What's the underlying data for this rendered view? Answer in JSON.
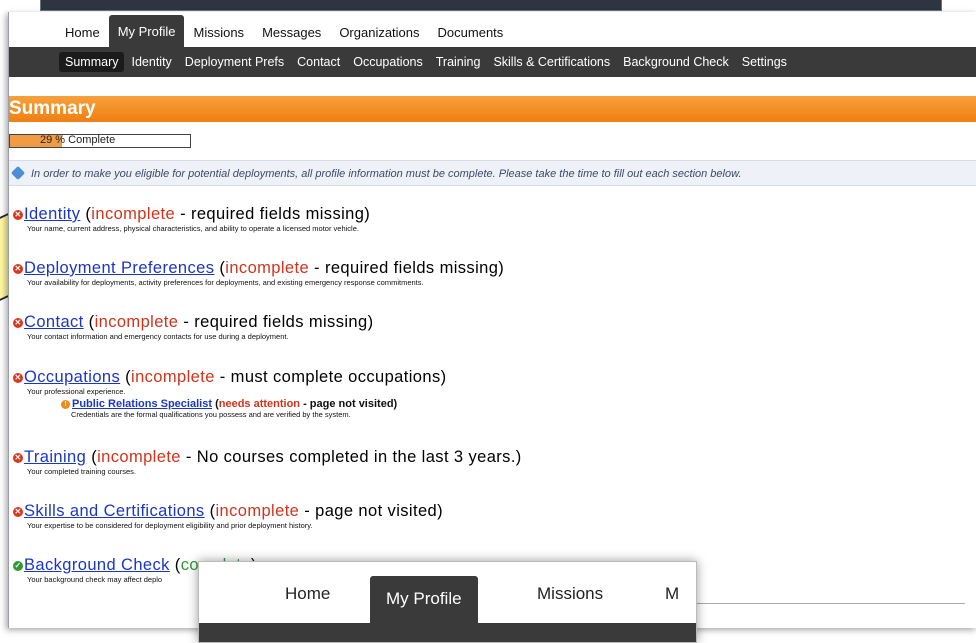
{
  "nav": {
    "main_tabs": [
      "Home",
      "My Profile",
      "Missions",
      "Messages",
      "Organizations",
      "Documents"
    ],
    "sub_tabs": [
      "Summary",
      "Identity",
      "Deployment Prefs",
      "Contact",
      "Occupations",
      "Training",
      "Skills & Certifications",
      "Background Check",
      "Settings"
    ]
  },
  "page": {
    "title": "Summary",
    "progress": {
      "percent": 29,
      "label": "29 % Complete"
    },
    "info_text": "In order to make you eligible for potential deployments, all profile information must be complete. Please take the time to fill out each section below."
  },
  "sections": {
    "identity": {
      "link": "Identity",
      "open": "(",
      "status": "incomplete",
      "rest": " - required fields missing)",
      "desc": "Your name, current address, physical characteristics, and ability to operate a licensed motor vehicle."
    },
    "deployment": {
      "link": "Deployment Preferences",
      "open": "(",
      "status": "incomplete",
      "rest": " - required fields missing)",
      "desc": "Your availability for deployments, activity preferences for deployments, and existing emergency response commitments."
    },
    "contact": {
      "link": "Contact",
      "open": "(",
      "status": "incomplete",
      "rest": " - required fields missing)",
      "desc": "Your contact information and emergency contacts for use during a deployment."
    },
    "occupations": {
      "link": "Occupations",
      "open": "(",
      "status": "incomplete",
      "rest": " - must complete occupations)",
      "desc": "Your professional experience.",
      "sub": {
        "link": "Public Relations Specialist",
        "open": "(",
        "status": "needs attention",
        "rest": " - page not visited)",
        "desc": "Credentials are the formal qualifications you possess and are verified by the system."
      }
    },
    "training": {
      "link": "Training",
      "open": "(",
      "status": "incomplete",
      "rest": " - No courses completed in the last 3 years.)",
      "desc": "Your completed training courses."
    },
    "skills": {
      "link": "Skills and Certifications",
      "open": "(",
      "status": "incomplete",
      "rest": " - page not visited)",
      "desc": "Your expertise to be considered for deployment eligibility and prior deployment history."
    },
    "background": {
      "link": "Background Check",
      "open": "(",
      "status": "complete",
      "rest": ")",
      "desc": "Your background check may affect deplo"
    }
  },
  "zoom": {
    "tabs": [
      "Home",
      "My Profile",
      "Missions",
      "M"
    ]
  },
  "colors": {
    "accent_orange": "#ef7f11",
    "nav_dark": "#3a3a3a",
    "link_blue": "#1b36c7",
    "status_red": "#d1341c",
    "ok_green": "#2f9a2f"
  }
}
